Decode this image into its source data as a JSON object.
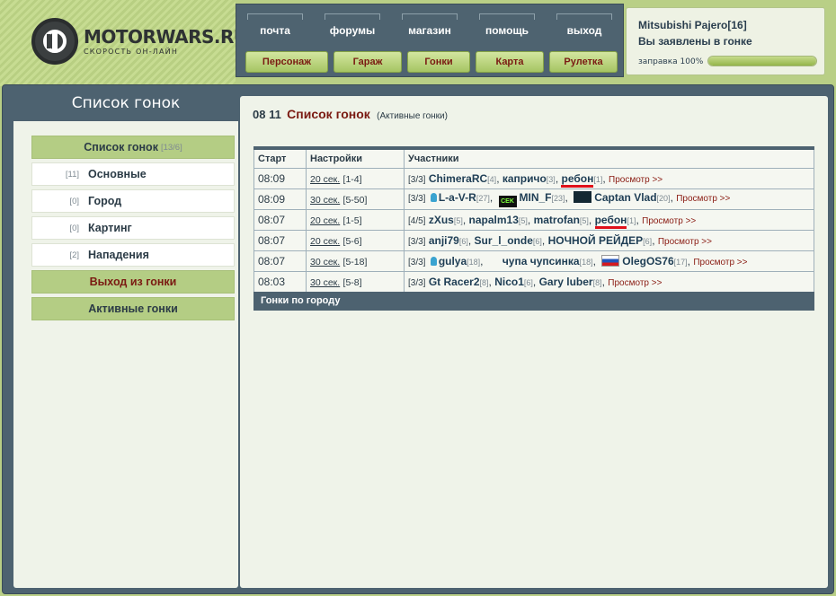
{
  "logo": {
    "title": "MOTORWARS.RU",
    "subtitle": "СКОРОСТЬ ОН-ЛАЙН"
  },
  "nav": {
    "top": [
      "почта",
      "форумы",
      "магазин",
      "помощь",
      "выход"
    ],
    "buttons": [
      "Персонаж",
      "Гараж",
      "Гонки",
      "Карта",
      "Рулетка"
    ]
  },
  "car": {
    "name": "Mitsubishi Pajero[16]",
    "status": "Вы заявлены в гонке",
    "fuel_label": "заправка 100%",
    "fuel_fraction": 1.0
  },
  "sidebar": {
    "heading": "Список гонок",
    "list_title": {
      "label": "Список гонок",
      "count": "[13/6]"
    },
    "items": [
      {
        "count": "[11]",
        "label": "Основные"
      },
      {
        "count": "[0]",
        "label": "Город"
      },
      {
        "count": "[0]",
        "label": "Картинг"
      },
      {
        "count": "[2]",
        "label": "Нападения"
      }
    ],
    "leave": "Выход из гонки",
    "active": "Активные гонки"
  },
  "content": {
    "date": "08 11",
    "title": "Список гонок",
    "subtitle": "(Активные гонки)",
    "columns": [
      "Старт",
      "Настройки",
      "Участники"
    ],
    "view_label": "Просмотр >>",
    "footer": "Гонки по городу",
    "rows": [
      {
        "start": "08:09",
        "time": "20 сек.",
        "range": "[1-4]",
        "count": "[3/3]",
        "players": [
          {
            "name": "ChimeraRC",
            "n": "[4]"
          },
          {
            "name": "капричо",
            "n": "[3]"
          },
          {
            "name": "ребон",
            "n": "[1]"
          }
        ]
      },
      {
        "start": "08:09",
        "time": "30 сек.",
        "range": "[5-50]",
        "count": "[3/3]",
        "players": [
          {
            "name": "L-a-V-R",
            "n": "[27]"
          },
          {
            "name": "MIN_F",
            "n": "[23]"
          },
          {
            "name": "Captan Vlad",
            "n": "[20]"
          }
        ]
      },
      {
        "start": "08:07",
        "time": "20 сек.",
        "range": "[1-5]",
        "count": "[4/5]",
        "players": [
          {
            "name": "zXus",
            "n": "[5]"
          },
          {
            "name": "napalm13",
            "n": "[5]"
          },
          {
            "name": "matrofan",
            "n": "[5]"
          },
          {
            "name": "ребон",
            "n": "[1]"
          }
        ]
      },
      {
        "start": "08:07",
        "time": "20 сек.",
        "range": "[5-6]",
        "count": "[3/3]",
        "players": [
          {
            "name": "anji79",
            "n": "[6]"
          },
          {
            "name": "Sur_l_onde",
            "n": "[6]"
          },
          {
            "name": "НОЧНОЙ РЕЙДЕР",
            "n": "[6]"
          }
        ]
      },
      {
        "start": "08:07",
        "time": "30 сек.",
        "range": "[5-18]",
        "count": "[3/3]",
        "players": [
          {
            "name": "gulya",
            "n": "[18]"
          },
          {
            "name": "чупа чупсинка",
            "n": "[18]"
          },
          {
            "name": "OlegOS76",
            "n": "[17]"
          }
        ]
      },
      {
        "start": "08:03",
        "time": "30 сек.",
        "range": "[5-8]",
        "count": "[3/3]",
        "players": [
          {
            "name": "Gt Racer2",
            "n": "[8]"
          },
          {
            "name": "Nico1",
            "n": "[6]"
          },
          {
            "name": "Gary luber",
            "n": "[8]"
          }
        ]
      }
    ]
  }
}
